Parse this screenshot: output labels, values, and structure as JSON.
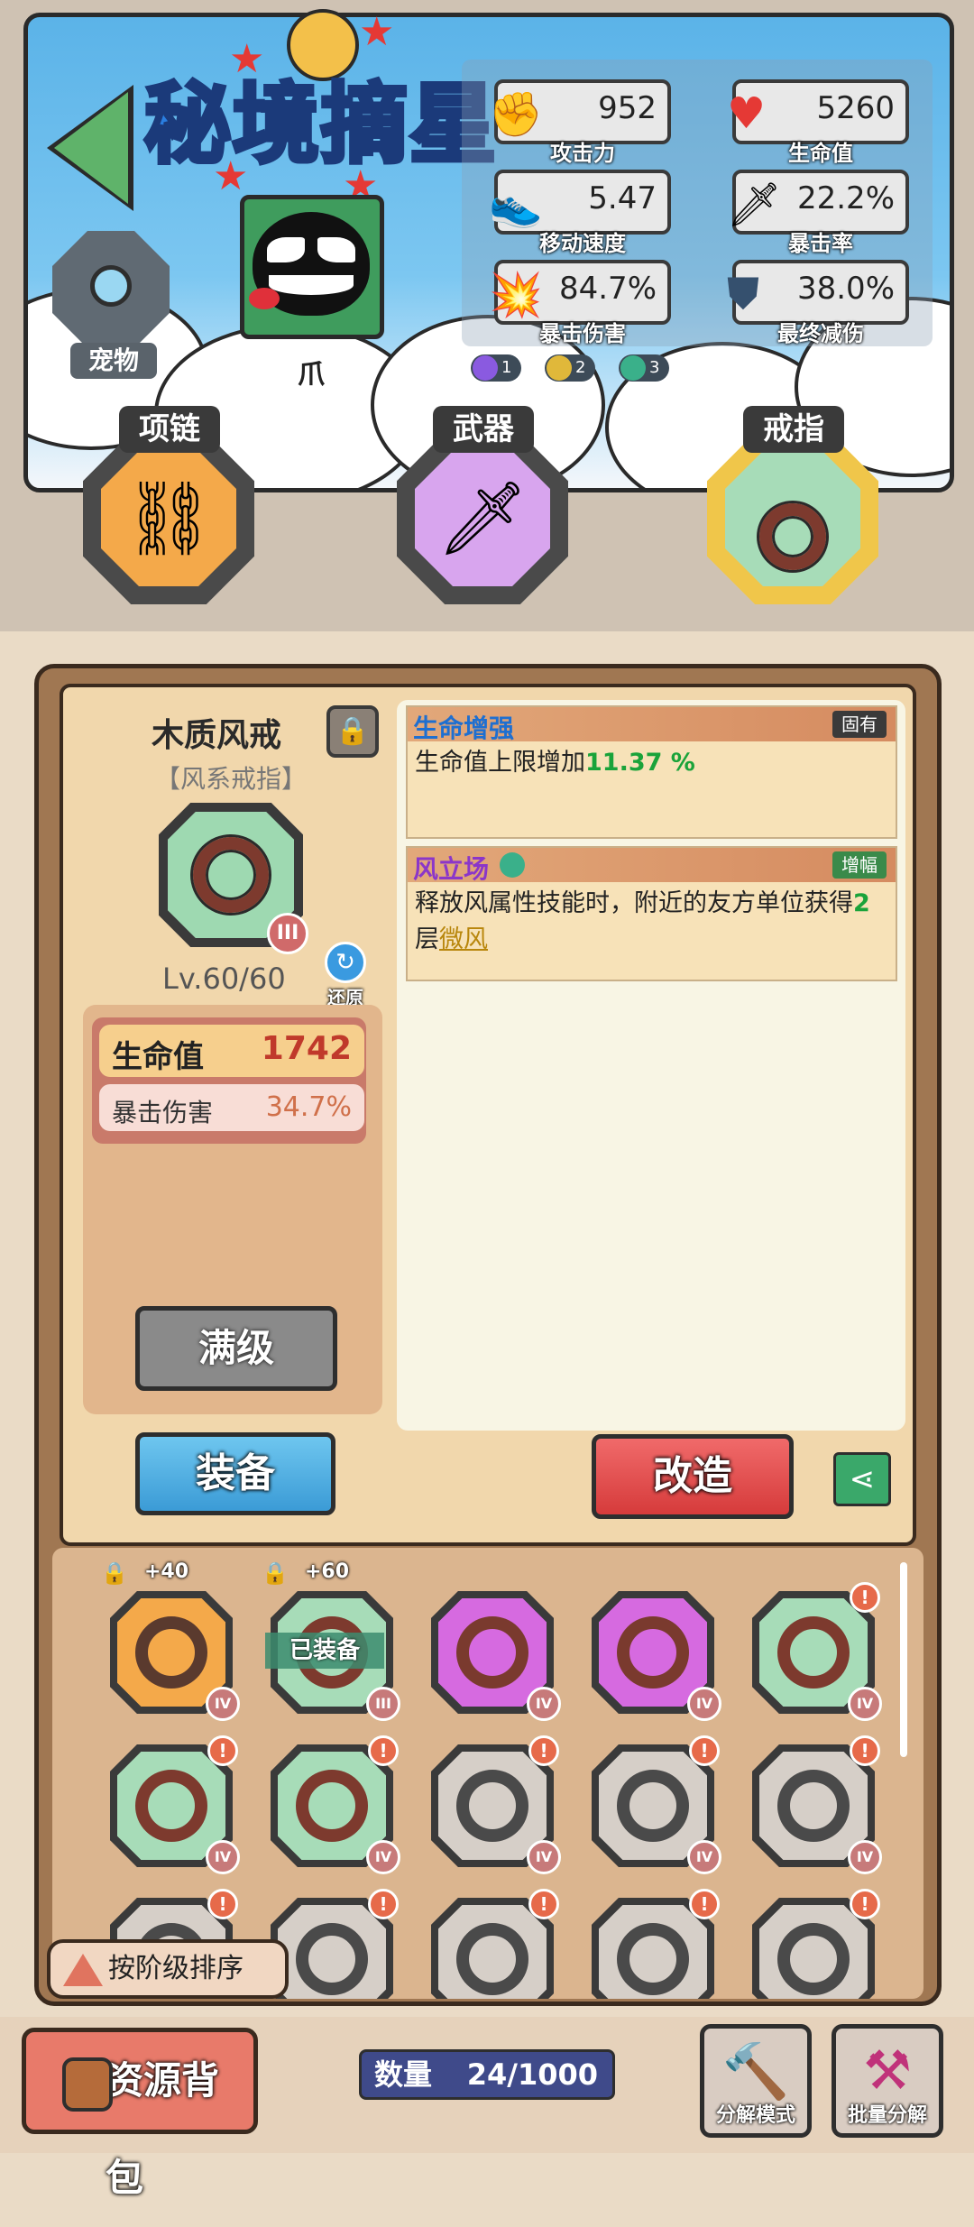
{
  "header": {
    "title": "秘境摘星",
    "pet_label": "宠物",
    "hero_name": "爪"
  },
  "stats": [
    {
      "value": "952",
      "label": "攻击力",
      "icon": "fist-icon"
    },
    {
      "value": "5260",
      "label": "生命值",
      "icon": "heart-icon"
    },
    {
      "value": "5.47",
      "label": "移动速度",
      "icon": "shoe-icon"
    },
    {
      "value": "22.2%",
      "label": "暴击率",
      "icon": "sword-icon"
    },
    {
      "value": "84.7%",
      "label": "暴击伤害",
      "icon": "explosion-icon"
    },
    {
      "value": "38.0%",
      "label": "最终减伤",
      "icon": "shield-icon"
    }
  ],
  "skill_badges": [
    "1",
    "2",
    "3"
  ],
  "equip_slots": [
    {
      "label": "项链",
      "icon": "necklace-icon",
      "selected": false
    },
    {
      "label": "武器",
      "icon": "sword-icon",
      "selected": false
    },
    {
      "label": "戒指",
      "icon": "ring-icon",
      "selected": true
    }
  ],
  "item": {
    "name": "木质风戒",
    "type": "【风系戒指】",
    "tier": "III",
    "level": "Lv.60/60",
    "restore_label": "还原",
    "attributes": [
      {
        "name": "生命值",
        "value": "1742"
      },
      {
        "name": "暴击伤害",
        "value": "34.7%"
      }
    ],
    "max_label": "满级"
  },
  "effects": [
    {
      "name": "生命增强",
      "badge": "固有",
      "desc_prefix": "生命值上限增加",
      "desc_highlight": "11.37 %",
      "desc_suffix": ""
    },
    {
      "name": "风立场",
      "badge": "增幅",
      "desc_prefix": "释放风属性技能时，附近的友方单位获得",
      "desc_highlight": "2",
      "desc_suffix": "层",
      "desc_keyword": "微风"
    }
  ],
  "actions": {
    "equip": "装备",
    "reforge": "改造"
  },
  "inventory": {
    "rows": [
      [
        {
          "rarity": "orange",
          "tier": "IV",
          "level": "+40",
          "locked": true,
          "new": false
        },
        {
          "rarity": "green",
          "tier": "III",
          "level": "+60",
          "locked": true,
          "new": false,
          "equipped": "已装备"
        },
        {
          "rarity": "purple",
          "tier": "IV",
          "new": false
        },
        {
          "rarity": "purple",
          "tier": "IV",
          "new": false
        },
        {
          "rarity": "green",
          "tier": "IV",
          "new": true
        }
      ],
      [
        {
          "rarity": "green",
          "tier": "IV",
          "new": true
        },
        {
          "rarity": "green",
          "tier": "IV",
          "new": true
        },
        {
          "rarity": "grey",
          "tier": "IV",
          "new": true
        },
        {
          "rarity": "grey",
          "tier": "IV",
          "new": true
        },
        {
          "rarity": "grey",
          "tier": "IV",
          "new": true
        }
      ],
      [
        {
          "rarity": "grey",
          "tier": "",
          "new": true
        },
        {
          "rarity": "grey",
          "tier": "",
          "new": true
        },
        {
          "rarity": "grey",
          "tier": "",
          "new": true
        },
        {
          "rarity": "grey",
          "tier": "",
          "new": true
        },
        {
          "rarity": "grey",
          "tier": "",
          "new": true
        }
      ]
    ],
    "new_mark": "!",
    "sort_label": "按阶级排序"
  },
  "bottom": {
    "backpack_label": "资源背包",
    "count_label": "数量",
    "count_value": "24/1000",
    "salvage_mode": "分解模式",
    "batch_salvage": "批量分解"
  },
  "colors": {
    "green": "#a7dcb8",
    "orange": "#f4a94a",
    "purple": "#d66ae0",
    "grey": "#d6cfc8"
  }
}
